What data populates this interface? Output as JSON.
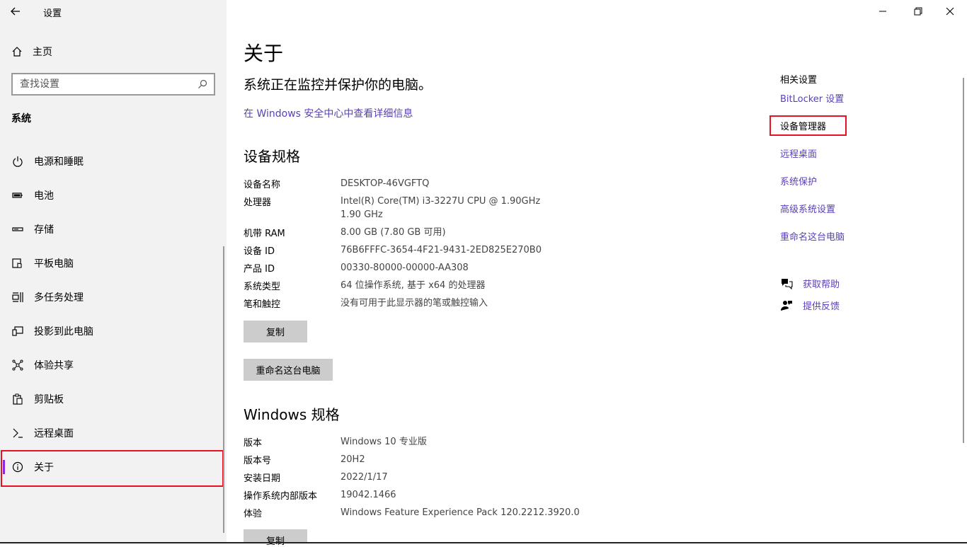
{
  "titlebar": {
    "title": "设置"
  },
  "sidebar": {
    "home": "主页",
    "search_placeholder": "查找设置",
    "section": "系统",
    "items": [
      {
        "label": "电源和睡眠",
        "icon": "power-icon"
      },
      {
        "label": "电池",
        "icon": "battery-icon"
      },
      {
        "label": "存储",
        "icon": "storage-icon"
      },
      {
        "label": "平板电脑",
        "icon": "tablet-icon"
      },
      {
        "label": "多任务处理",
        "icon": "multitasking-icon"
      },
      {
        "label": "投影到此电脑",
        "icon": "projecting-icon"
      },
      {
        "label": "体验共享",
        "icon": "shared-experiences-icon"
      },
      {
        "label": "剪贴板",
        "icon": "clipboard-icon"
      },
      {
        "label": "远程桌面",
        "icon": "remote-desktop-icon"
      },
      {
        "label": "关于",
        "icon": "info-icon",
        "active": true
      }
    ]
  },
  "main": {
    "title": "关于",
    "status": "系统正在监控并保护你的电脑。",
    "security_link": "在 Windows 安全中心中查看详细信息",
    "device_specs": {
      "heading": "设备规格",
      "rows": [
        {
          "k": "设备名称",
          "v": "DESKTOP-46VGFTQ"
        },
        {
          "k": "处理器",
          "v": "Intel(R) Core(TM) i3-3227U CPU @ 1.90GHz   1.90 GHz"
        },
        {
          "k": "机带 RAM",
          "v": "8.00 GB (7.80 GB 可用)"
        },
        {
          "k": "设备 ID",
          "v": "76B6FFFC-3654-4F21-9431-2ED825E270B0"
        },
        {
          "k": "产品 ID",
          "v": "00330-80000-00000-AA308"
        },
        {
          "k": "系统类型",
          "v": "64 位操作系统, 基于 x64 的处理器"
        },
        {
          "k": "笔和触控",
          "v": "没有可用于此显示器的笔或触控输入"
        }
      ],
      "copy_button": "复制",
      "rename_button": "重命名这台电脑"
    },
    "windows_specs": {
      "heading": "Windows 规格",
      "rows": [
        {
          "k": "版本",
          "v": "Windows 10 专业版"
        },
        {
          "k": "版本号",
          "v": "20H2"
        },
        {
          "k": "安装日期",
          "v": "2022/1/17"
        },
        {
          "k": "操作系统内部版本",
          "v": "19042.1466"
        },
        {
          "k": "体验",
          "v": "Windows Feature Experience Pack 120.2212.3920.0"
        }
      ],
      "copy_button": "复制"
    }
  },
  "related": {
    "title": "相关设置",
    "links": [
      "BitLocker 设置",
      "设备管理器",
      "远程桌面",
      "系统保护",
      "高级系统设置",
      "重命名这台电脑"
    ],
    "help": "获取帮助",
    "feedback": "提供反馈"
  },
  "colors": {
    "accent": "#5a3fb8",
    "highlight": "#e81123",
    "sidebar_bg": "#f2f2f2"
  }
}
